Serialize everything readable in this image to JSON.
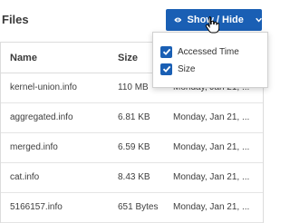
{
  "header": {
    "title": "Files",
    "toggle_label": "Show / Hide"
  },
  "table": {
    "columns": [
      "Name",
      "Size"
    ],
    "rows": [
      {
        "name": "kernel-union.info",
        "size": "110 MB",
        "time": "Monday, Jan 21, ..."
      },
      {
        "name": "aggregated.info",
        "size": "6.81 KB",
        "time": "Monday, Jan 21, ..."
      },
      {
        "name": "merged.info",
        "size": "6.59 KB",
        "time": "Monday, Jan 21, ..."
      },
      {
        "name": "cat.info",
        "size": "8.43 KB",
        "time": "Monday, Jan 21, ..."
      },
      {
        "name": "5166157.info",
        "size": "651 Bytes",
        "time": "Monday, Jan 21, ..."
      }
    ]
  },
  "dropdown": {
    "options": [
      {
        "label": "Accessed Time",
        "checked": true
      },
      {
        "label": "Size",
        "checked": true
      }
    ]
  },
  "icons": {
    "toggle_leading": "eye-icon",
    "toggle_trailing": "chevron-down-icon",
    "pointer": "hand-cursor-icon"
  },
  "colors": {
    "accent": "#1a5fb4"
  }
}
